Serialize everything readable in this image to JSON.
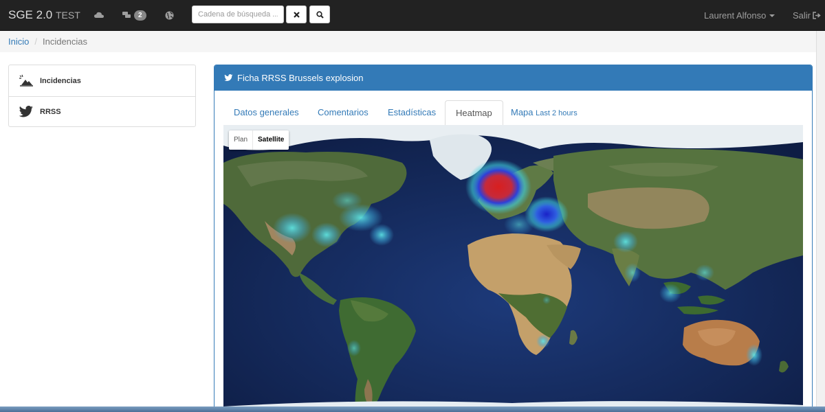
{
  "navbar": {
    "brand": "SGE 2.0",
    "brand_sub": "TEST",
    "messages_badge": "2",
    "search_placeholder": "Cadena de búsqueda ...",
    "user_name": "Laurent Alfonso",
    "logout_label": "Salir"
  },
  "breadcrumb": {
    "home": "Inicio",
    "current": "Incidencias"
  },
  "sidebar": {
    "items": [
      {
        "label": "Incidencias",
        "icon": "disaster-icon"
      },
      {
        "label": "RRSS",
        "icon": "twitter-icon"
      }
    ]
  },
  "panel": {
    "title": "Ficha RRSS Brussels explosion",
    "tabs": [
      {
        "label": "Datos generales",
        "active": false
      },
      {
        "label": "Comentarios",
        "active": false
      },
      {
        "label": "Estadísticas",
        "active": false
      },
      {
        "label": "Heatmap",
        "active": true
      },
      {
        "label": "Mapa",
        "sub": "Last 2 hours",
        "active": false
      }
    ]
  },
  "map": {
    "type_options": [
      "Plan",
      "Satellite"
    ],
    "selected_type": "Satellite",
    "hotspot_colors": {
      "high": "#d81f1f",
      "mid": "#2f3fd8",
      "low": "#3fd0e0"
    }
  }
}
